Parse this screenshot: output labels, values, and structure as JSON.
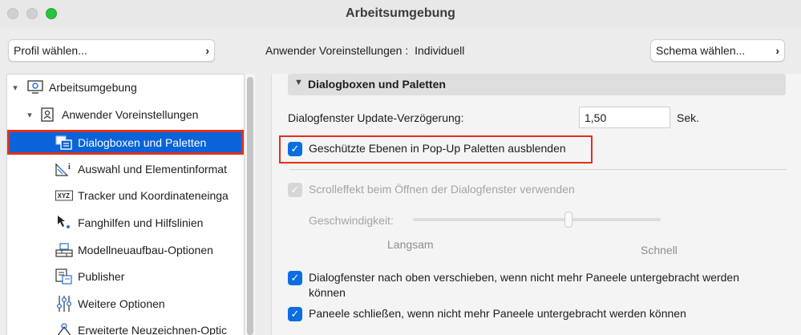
{
  "window": {
    "title": "Arbeitsumgebung"
  },
  "toolbar": {
    "profile_label": "Profil wählen...",
    "prefs_caption": "Anwender Voreinstellungen :",
    "prefs_value": "Individuell",
    "schema_label": "Schema wählen..."
  },
  "tree": {
    "items": [
      {
        "label": "Arbeitsumgebung",
        "icon": "workspace-icon",
        "arrow": "▾"
      },
      {
        "label": "Anwender Voreinstellungen",
        "icon": "user-prefs-icon",
        "arrow": "▾"
      },
      {
        "label": "Dialogboxen und Paletten",
        "icon": "dialog-palette-icon"
      },
      {
        "label": "Auswahl und Elementinformat",
        "icon": "selection-info-icon"
      },
      {
        "label": "Tracker und Koordinateneinga",
        "icon": "xyz-tracker-icon"
      },
      {
        "label": "Fanghilfen und Hilfslinien",
        "icon": "snap-guides-icon"
      },
      {
        "label": "Modellneuaufbau-Optionen",
        "icon": "model-rebuild-icon"
      },
      {
        "label": "Publisher",
        "icon": "publisher-icon"
      },
      {
        "label": "Weitere Optionen",
        "icon": "more-options-icon"
      },
      {
        "label": "Erweiterte Neuzeichnen-Optic",
        "icon": "redraw-options-icon"
      }
    ]
  },
  "section": {
    "title": "Dialogboxen und Paletten"
  },
  "settings": {
    "update_delay_label": "Dialogfenster Update-Verzögerung:",
    "update_delay_value": "1,50",
    "update_delay_unit": "Sek.",
    "hide_protected_label": "Geschützte Ebenen in Pop-Up Paletten ausblenden",
    "hide_protected_checked": true,
    "scroll_effect_label": "Scrolleffekt beim Öffnen der Dialogfenster verwenden",
    "scroll_effect_checked": true,
    "scroll_effect_enabled": false,
    "speed_label": "Geschwindigkeit:",
    "speed_value_fraction": 0.62,
    "speed_min_label": "Langsam",
    "speed_max_label": "Schnell",
    "move_up_label_line1": "Dialogfenster nach oben verschieben, wenn nicht mehr Paneele untergebracht werden",
    "move_up_label_line2": "können",
    "move_up_checked": true,
    "close_panels_label": "Paneele schließen, wenn nicht mehr Paneele untergebracht werden können",
    "close_panels_checked": true
  },
  "colors": {
    "accent": "#0a63d9",
    "highlight_border": "#e0301e"
  }
}
